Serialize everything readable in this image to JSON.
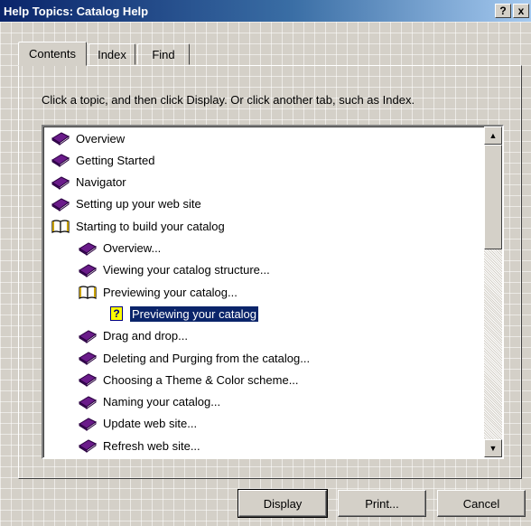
{
  "window": {
    "title": "Help Topics: Catalog Help",
    "help_btn": "?",
    "close_btn": "x"
  },
  "tabs": [
    {
      "label": "Contents",
      "active": true
    },
    {
      "label": "Index",
      "active": false
    },
    {
      "label": "Find",
      "active": false
    }
  ],
  "instruction": "Click a topic, and then click Display. Or click another tab, such as Index.",
  "tree": [
    {
      "label": "Overview",
      "level": 0,
      "icon": "closed-book-icon"
    },
    {
      "label": "Getting Started",
      "level": 0,
      "icon": "closed-book-icon"
    },
    {
      "label": "Navigator",
      "level": 0,
      "icon": "closed-book-icon"
    },
    {
      "label": "Setting up your web site",
      "level": 0,
      "icon": "closed-book-icon"
    },
    {
      "label": "Starting to build your catalog",
      "level": 0,
      "icon": "open-book-icon"
    },
    {
      "label": "Overview...",
      "level": 1,
      "icon": "closed-book-icon"
    },
    {
      "label": "Viewing your catalog structure...",
      "level": 1,
      "icon": "closed-book-icon"
    },
    {
      "label": "Previewing your catalog...",
      "level": 1,
      "icon": "open-book-icon"
    },
    {
      "label": "Previewing your catalog",
      "level": 2,
      "icon": "help-page-icon",
      "selected": true
    },
    {
      "label": "Drag and drop...",
      "level": 1,
      "icon": "closed-book-icon"
    },
    {
      "label": "Deleting and Purging from the catalog...",
      "level": 1,
      "icon": "closed-book-icon"
    },
    {
      "label": "Choosing a Theme & Color scheme...",
      "level": 1,
      "icon": "closed-book-icon"
    },
    {
      "label": "Naming your catalog...",
      "level": 1,
      "icon": "closed-book-icon"
    },
    {
      "label": "Update web site...",
      "level": 1,
      "icon": "closed-book-icon"
    },
    {
      "label": "Refresh web site...",
      "level": 1,
      "icon": "closed-book-icon"
    }
  ],
  "buttons": {
    "display": "Display",
    "print": "Print...",
    "cancel": "Cancel"
  },
  "colors": {
    "title_bar": "#0a246a",
    "book": "#6a1b8a",
    "selection": "#0a246a"
  }
}
